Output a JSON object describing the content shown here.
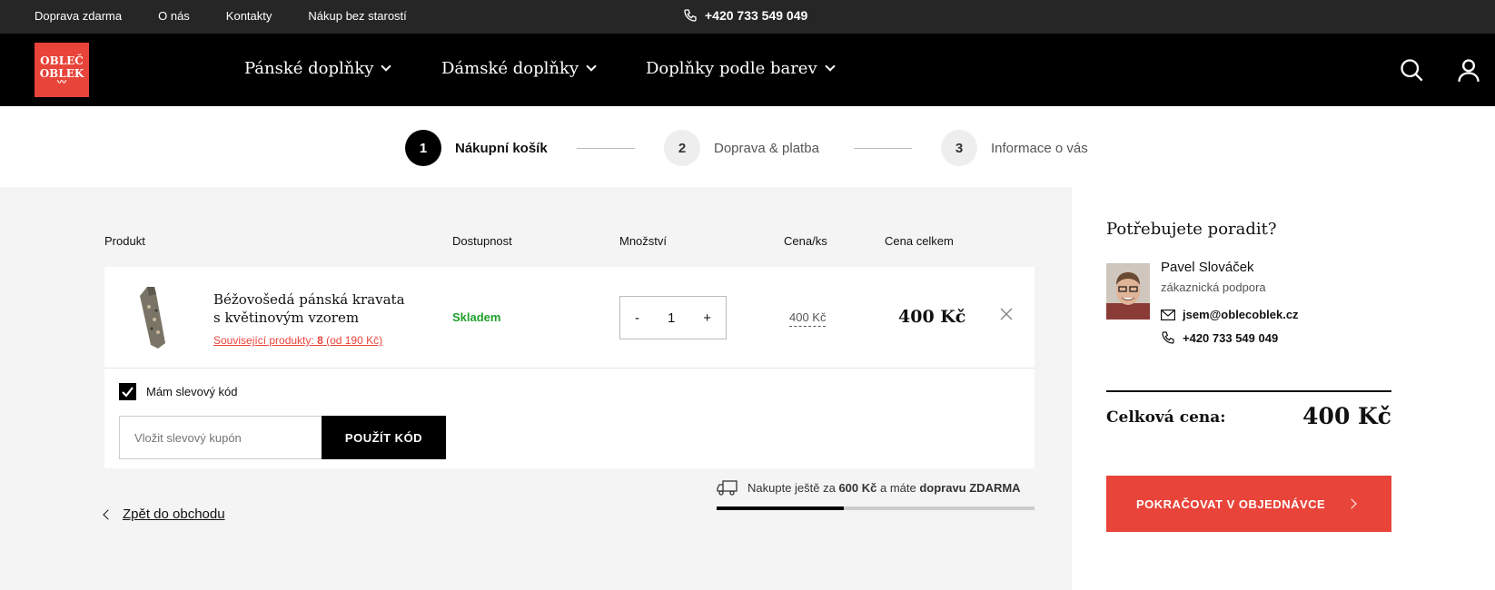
{
  "topbar": {
    "links": [
      "Doprava zdarma",
      "O nás",
      "Kontakty",
      "Nákup bez starostí"
    ],
    "phone": "+420 733 549 049"
  },
  "logo": {
    "line1": "OBLEČ",
    "line2": "OBLEK"
  },
  "nav": {
    "items": [
      "Pánské doplňky",
      "Dámské doplňky",
      "Doplňky podle barev"
    ],
    "icons": [
      "search-icon",
      "user-icon"
    ]
  },
  "steps": [
    {
      "num": "1",
      "label": "Nákupní košík"
    },
    {
      "num": "2",
      "label": "Doprava & platba"
    },
    {
      "num": "3",
      "label": "Informace o vás"
    }
  ],
  "table": {
    "headers": [
      "Produkt",
      "Dostupnost",
      "Množství",
      "Cena/ks",
      "Cena celkem"
    ],
    "item": {
      "name": "Béžovošedá pánská kravata s květinovým vzorem",
      "related_prefix": "Související produkty: ",
      "related_count": "8",
      "related_suffix": " (od 190 Kč)",
      "availability": "Skladem",
      "quantity": "1",
      "minus": "-",
      "plus": "+",
      "unit_price": "400 Kč",
      "total_price": "400 Kč"
    }
  },
  "coupon": {
    "checkbox_label": "Mám slevový kód",
    "placeholder": "Vložit slevový kupón",
    "button": "POUŽÍT KÓD"
  },
  "back_link": "Zpět do obchodu",
  "shipping": {
    "prefix": "Nakupte ještě za ",
    "amount": "600 Kč",
    "middle": " a máte ",
    "suffix": "dopravu ZDARMA",
    "progress": 0.4
  },
  "support": {
    "heading": "Potřebujete poradit?",
    "name": "Pavel Slováček",
    "role": "zákaznická podpora",
    "email": "jsem@oblecoblek.cz",
    "phone": "+420 733 549 049"
  },
  "summary": {
    "label": "Celková cena:",
    "value": "400 Kč",
    "continue_button": "POKRAČOVAT V OBJEDNÁVCE"
  },
  "colors": {
    "brand": "#e8443a",
    "stock": "#1fa12b",
    "dark": "#000000"
  }
}
